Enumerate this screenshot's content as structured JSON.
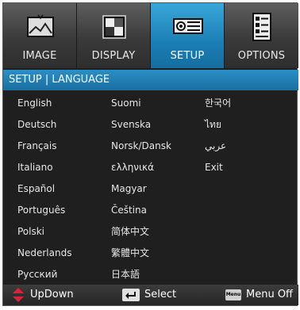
{
  "tabs": [
    {
      "label": "IMAGE",
      "icon": "image-icon",
      "active": false
    },
    {
      "label": "DISPLAY",
      "icon": "display-icon",
      "active": false
    },
    {
      "label": "SETUP",
      "icon": "projector-icon",
      "active": true
    },
    {
      "label": "OPTIONS",
      "icon": "options-icon",
      "active": false
    }
  ],
  "section_title": "SETUP | LANGUAGE",
  "languages": {
    "col1": [
      "English",
      "Deutsch",
      "Français",
      "Italiano",
      "Español",
      "Português",
      "Polski",
      "Nederlands",
      "Русский"
    ],
    "col2": [
      "Suomi",
      "Svenska",
      "Norsk/Dansk",
      "ελληνικά",
      "Magyar",
      "Čeština",
      "简体中文",
      "繁體中文",
      "日本語"
    ],
    "col3": [
      "한국어",
      "ไทย",
      "عربي",
      "Exit"
    ]
  },
  "footer": {
    "updown": "UpDown",
    "select": "Select",
    "menu_key": "Menu",
    "menu_off": "Menu Off"
  },
  "colors": {
    "active_tab": "#1a7fb6",
    "header": "#2b8fc6",
    "background": "#1f1f1f",
    "updown_icon": "#e0203a"
  }
}
